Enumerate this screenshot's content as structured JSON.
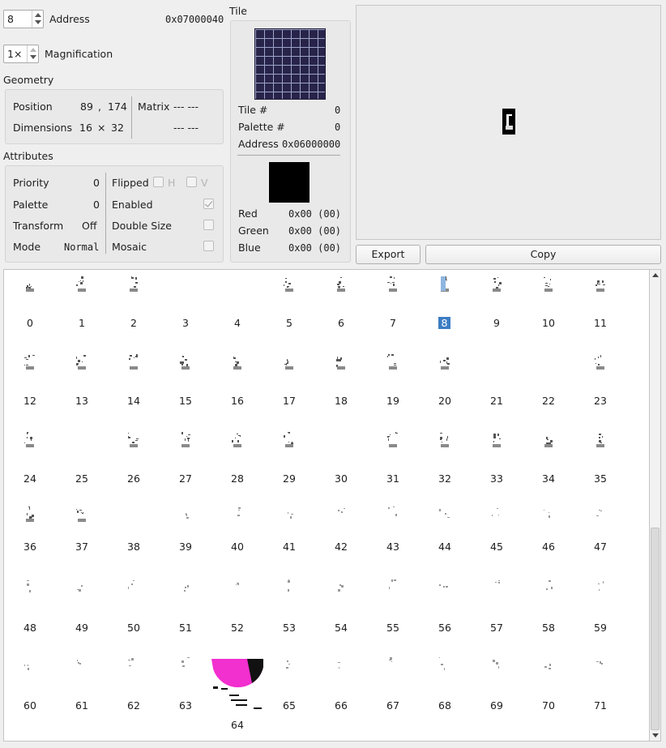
{
  "header": {
    "sprite_index": "8",
    "address_label": "Address",
    "address_value": "0x07000040",
    "magnification_value": "1×",
    "magnification_label": "Magnification"
  },
  "geometry": {
    "title": "Geometry",
    "position_label": "Position",
    "position_x": "89",
    "position_sep": ",",
    "position_y": "174",
    "dimensions_label": "Dimensions",
    "dim_w": "16",
    "dim_sep": "×",
    "dim_h": "32",
    "matrix_label": "Matrix",
    "matrix_row1": "--- ---",
    "matrix_row2": "--- ---"
  },
  "attributes": {
    "title": "Attributes",
    "priority_label": "Priority",
    "priority_value": "0",
    "palette_label": "Palette",
    "palette_value": "0",
    "transform_label": "Transform",
    "transform_value": "Off",
    "mode_label": "Mode",
    "mode_value": "Normal",
    "flipped_label": "Flipped",
    "flip_h": "H",
    "flip_v": "V",
    "enabled_label": "Enabled",
    "double_size_label": "Double Size",
    "mosaic_label": "Mosaic"
  },
  "tile": {
    "title": "Tile",
    "tile_num_label": "Tile #",
    "tile_num_value": "0",
    "palette_num_label": "Palette #",
    "palette_num_value": "0",
    "address_label": "Address",
    "address_value": "0x06000000",
    "red_label": "Red",
    "red_value": "0x00 (00)",
    "green_label": "Green",
    "green_value": "0x00 (00)",
    "blue_label": "Blue",
    "blue_value": "0x00 (00)",
    "swatch_color": "#000000"
  },
  "actions": {
    "export_label": "Export",
    "copy_label": "Copy"
  },
  "sprite_list": {
    "selected": "8",
    "rows": [
      [
        "0",
        "1",
        "2",
        "3",
        "4",
        "5",
        "6",
        "7",
        "8",
        "9",
        "10",
        "11"
      ],
      [
        "12",
        "13",
        "14",
        "15",
        "16",
        "17",
        "18",
        "19",
        "20",
        "21",
        "22",
        "23"
      ],
      [
        "24",
        "25",
        "26",
        "27",
        "28",
        "29",
        "30",
        "31",
        "32",
        "33",
        "34",
        "35"
      ],
      [
        "36",
        "37",
        "38",
        "39",
        "40",
        "41",
        "42",
        "43",
        "44",
        "45",
        "46",
        "47"
      ],
      [
        "48",
        "49",
        "50",
        "51",
        "52",
        "53",
        "54",
        "55",
        "56",
        "57",
        "58",
        "59"
      ],
      [
        "60",
        "61",
        "62",
        "63",
        "64",
        "65",
        "66",
        "67",
        "68",
        "69",
        "70",
        "71"
      ]
    ],
    "colors": {
      "magenta": "#f22fcf",
      "selection": "#3d7dc4"
    }
  }
}
